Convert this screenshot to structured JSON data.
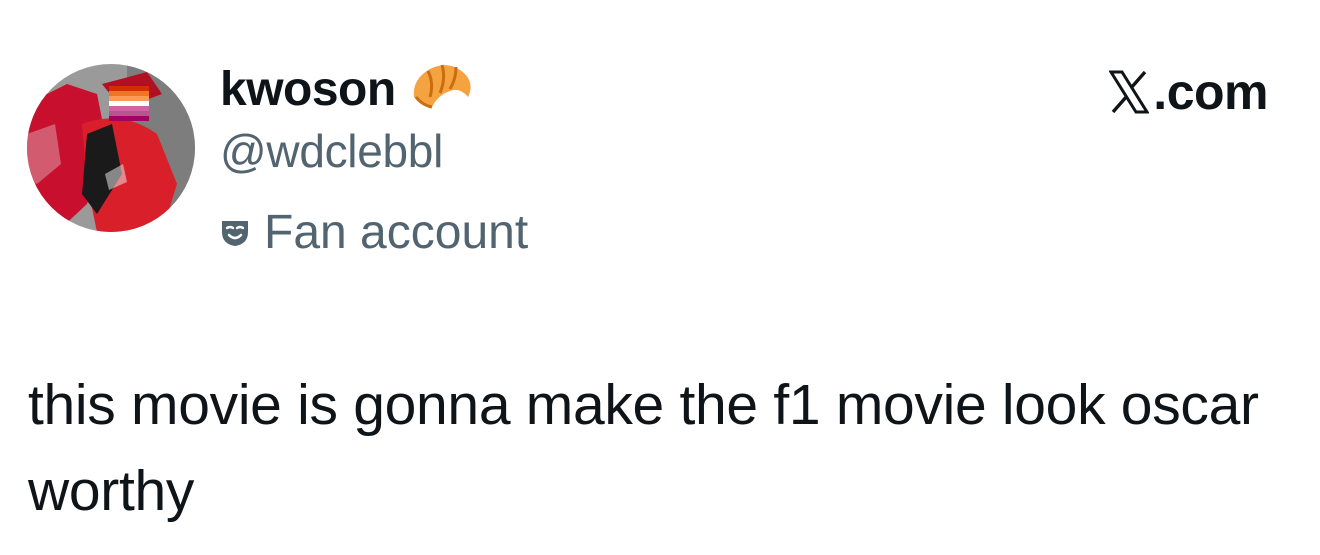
{
  "author": {
    "display_name": "kwoson",
    "name_emoji": "croissant-emoji",
    "handle": "@wdclebbl",
    "account_label": "Fan account",
    "label_icon": "theater-mask-icon",
    "avatar": "avatar-image"
  },
  "brand": {
    "logo": "x-logo-icon",
    "text": ".com"
  },
  "tweet": {
    "text": "this movie is gonna make the f1 movie look oscar worthy"
  },
  "colors": {
    "primary_text": "#0f1419",
    "secondary_text": "#536471",
    "background": "#ffffff"
  }
}
